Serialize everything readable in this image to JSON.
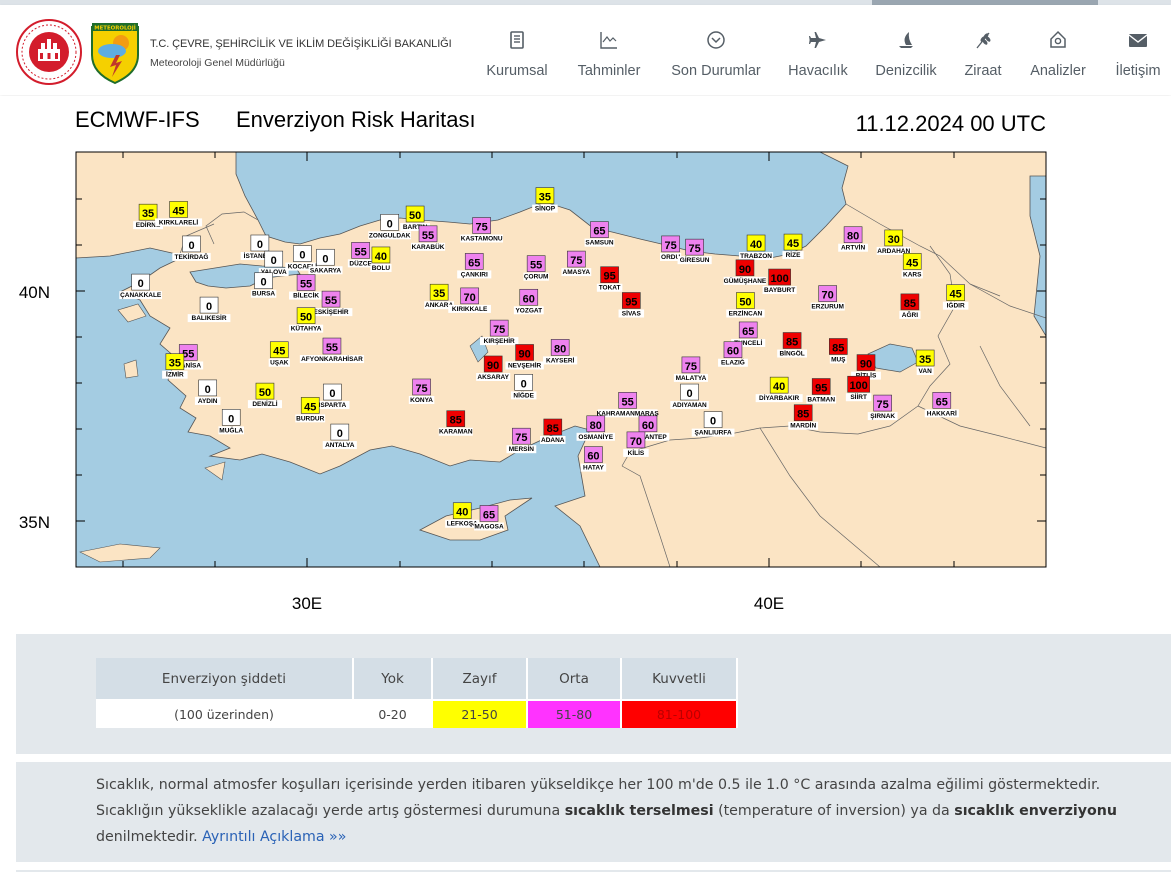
{
  "header": {
    "org_line1": "T.C. ÇEVRE, ŞEHİRCİLİK VE İKLİM DEĞİŞİKLİĞİ BAKANLIĞI",
    "org_line2": "Meteoroloji Genel Müdürlüğü",
    "logo_text": "METEOROLOJİ"
  },
  "nav": [
    {
      "label": "Kurumsal",
      "icon": "document-icon"
    },
    {
      "label": "Tahminler",
      "icon": "chart-icon"
    },
    {
      "label": "Son Durumlar",
      "icon": "chevron-circle-icon"
    },
    {
      "label": "Havacılık",
      "icon": "airplane-icon"
    },
    {
      "label": "Denizcilik",
      "icon": "sailboat-icon"
    },
    {
      "label": "Ziraat",
      "icon": "wheat-icon"
    },
    {
      "label": "Analizler",
      "icon": "analysis-icon"
    },
    {
      "label": "İletişim",
      "icon": "envelope-icon"
    }
  ],
  "map": {
    "model": "ECMWF-IFS",
    "title": "Enverziyon Risk Haritası",
    "date": "11.12.2024 00 UTC",
    "lat_labels": [
      "40N",
      "35N"
    ],
    "lon_labels": [
      "30E",
      "40E"
    ],
    "colors": {
      "yok": "#ffffff",
      "zayif": "#ffff00",
      "orta": "#ee82ee",
      "kuvvetli": "#ee0000",
      "land": "#fbe4c4",
      "sea": "#a4cce2"
    },
    "stations": [
      {
        "name": "EDİRNE",
        "value": "35",
        "lon": 26.56,
        "lat": 41.67
      },
      {
        "name": "KIRKLARELİ",
        "value": "45",
        "lon": 27.22,
        "lat": 41.73
      },
      {
        "name": "TEKİRDAĞ",
        "value": "0",
        "lon": 27.5,
        "lat": 40.98
      },
      {
        "name": "ÇANAKKALE",
        "value": "0",
        "lon": 26.4,
        "lat": 40.15
      },
      {
        "name": "İSTANBUL",
        "value": "0",
        "lon": 28.98,
        "lat": 41.0
      },
      {
        "name": "KOCAELİ",
        "value": "0",
        "lon": 29.9,
        "lat": 40.77
      },
      {
        "name": "YALOVA",
        "value": "0",
        "lon": 29.28,
        "lat": 40.65
      },
      {
        "name": "BURSA",
        "value": "0",
        "lon": 29.06,
        "lat": 40.18
      },
      {
        "name": "SAKARYA",
        "value": "0",
        "lon": 30.4,
        "lat": 40.69
      },
      {
        "name": "DÜZCE",
        "value": "55",
        "lon": 31.16,
        "lat": 40.84
      },
      {
        "name": "ZONGULDAK",
        "value": "0",
        "lon": 31.79,
        "lat": 41.45
      },
      {
        "name": "BARTIN",
        "value": "50",
        "lon": 32.34,
        "lat": 41.63
      },
      {
        "name": "KARABÜK",
        "value": "55",
        "lon": 32.62,
        "lat": 41.2
      },
      {
        "name": "BOLU",
        "value": "40",
        "lon": 31.6,
        "lat": 40.74
      },
      {
        "name": "KASTAMONU",
        "value": "75",
        "lon": 33.78,
        "lat": 41.38
      },
      {
        "name": "SİNOP",
        "value": "35",
        "lon": 35.15,
        "lat": 42.03
      },
      {
        "name": "SAMSUN",
        "value": "65",
        "lon": 36.33,
        "lat": 41.29
      },
      {
        "name": "ÇANKIRI",
        "value": "65",
        "lon": 33.62,
        "lat": 40.6
      },
      {
        "name": "ÇORUM",
        "value": "55",
        "lon": 34.96,
        "lat": 40.55
      },
      {
        "name": "AMASYA",
        "value": "75",
        "lon": 35.83,
        "lat": 40.65
      },
      {
        "name": "TOKAT",
        "value": "95",
        "lon": 36.55,
        "lat": 40.31
      },
      {
        "name": "ORDU",
        "value": "75",
        "lon": 37.87,
        "lat": 40.98
      },
      {
        "name": "GİRESUN",
        "value": "75",
        "lon": 38.39,
        "lat": 40.91
      },
      {
        "name": "TRABZON",
        "value": "40",
        "lon": 39.72,
        "lat": 41.0
      },
      {
        "name": "RİZE",
        "value": "45",
        "lon": 40.52,
        "lat": 41.02
      },
      {
        "name": "ARTVİN",
        "value": "80",
        "lon": 41.82,
        "lat": 41.18
      },
      {
        "name": "ARDAHAN",
        "value": "30",
        "lon": 42.7,
        "lat": 41.11
      },
      {
        "name": "GÜMÜŞHANE",
        "value": "90",
        "lon": 39.48,
        "lat": 40.46
      },
      {
        "name": "BAYBURT",
        "value": "100",
        "lon": 40.23,
        "lat": 40.26
      },
      {
        "name": "KARS",
        "value": "45",
        "lon": 43.1,
        "lat": 40.6
      },
      {
        "name": "IĞDIR",
        "value": "45",
        "lon": 44.04,
        "lat": 39.92
      },
      {
        "name": "ERZURUM",
        "value": "70",
        "lon": 41.27,
        "lat": 39.9
      },
      {
        "name": "ERZİNCAN",
        "value": "50",
        "lon": 39.49,
        "lat": 39.75
      },
      {
        "name": "AĞRI",
        "value": "85",
        "lon": 43.05,
        "lat": 39.72
      },
      {
        "name": "BİLECİK",
        "value": "55",
        "lon": 29.98,
        "lat": 40.14
      },
      {
        "name": "ESKİŞEHİR",
        "value": "55",
        "lon": 30.52,
        "lat": 39.78
      },
      {
        "name": "KÜTAHYA",
        "value": "50",
        "lon": 29.98,
        "lat": 39.42
      },
      {
        "name": "BALIKESİR",
        "value": "0",
        "lon": 27.88,
        "lat": 39.65
      },
      {
        "name": "ANKARA",
        "value": "35",
        "lon": 32.86,
        "lat": 39.93
      },
      {
        "name": "KIRIKKALE",
        "value": "70",
        "lon": 33.52,
        "lat": 39.85
      },
      {
        "name": "YOZGAT",
        "value": "60",
        "lon": 34.8,
        "lat": 39.82
      },
      {
        "name": "SİVAS",
        "value": "95",
        "lon": 37.02,
        "lat": 39.75
      },
      {
        "name": "TUNCELİ",
        "value": "65",
        "lon": 39.55,
        "lat": 39.11
      },
      {
        "name": "BİNGÖL",
        "value": "85",
        "lon": 40.5,
        "lat": 38.88
      },
      {
        "name": "MUŞ",
        "value": "85",
        "lon": 41.5,
        "lat": 38.75
      },
      {
        "name": "KIRŞEHİR",
        "value": "75",
        "lon": 34.16,
        "lat": 39.15
      },
      {
        "name": "NEVŞEHİR",
        "value": "90",
        "lon": 34.71,
        "lat": 38.62
      },
      {
        "name": "AKSARAY",
        "value": "90",
        "lon": 34.03,
        "lat": 38.37
      },
      {
        "name": "KAYSERİ",
        "value": "80",
        "lon": 35.48,
        "lat": 38.73
      },
      {
        "name": "MALATYA",
        "value": "75",
        "lon": 38.31,
        "lat": 38.35
      },
      {
        "name": "ELAZIĞ",
        "value": "60",
        "lon": 39.22,
        "lat": 38.68
      },
      {
        "name": "BİTLİS",
        "value": "90",
        "lon": 42.1,
        "lat": 38.4
      },
      {
        "name": "VAN",
        "value": "35",
        "lon": 43.38,
        "lat": 38.5
      },
      {
        "name": "SİİRT",
        "value": "100",
        "lon": 41.94,
        "lat": 37.93
      },
      {
        "name": "BATMAN",
        "value": "95",
        "lon": 41.13,
        "lat": 37.88
      },
      {
        "name": "DİYARBAKIR",
        "value": "40",
        "lon": 40.22,
        "lat": 37.91
      },
      {
        "name": "ŞIRNAK",
        "value": "75",
        "lon": 42.46,
        "lat": 37.52
      },
      {
        "name": "HAKKARİ",
        "value": "65",
        "lon": 43.74,
        "lat": 37.58
      },
      {
        "name": "MARDİN",
        "value": "85",
        "lon": 40.74,
        "lat": 37.31
      },
      {
        "name": "ADIYAMAN",
        "value": "0",
        "lon": 38.28,
        "lat": 37.76
      },
      {
        "name": "ŞANLIURFA",
        "value": "0",
        "lon": 38.79,
        "lat": 37.16
      },
      {
        "name": "KAHRAMANMARAŞ",
        "value": "55",
        "lon": 36.94,
        "lat": 37.58
      },
      {
        "name": "GAZİANTEP",
        "value": "60",
        "lon": 37.38,
        "lat": 37.07
      },
      {
        "name": "KİLİS",
        "value": "70",
        "lon": 37.12,
        "lat": 36.72
      },
      {
        "name": "OSMANİYE",
        "value": "80",
        "lon": 36.25,
        "lat": 37.07
      },
      {
        "name": "ADANA",
        "value": "85",
        "lon": 35.32,
        "lat": 37.0
      },
      {
        "name": "HATAY",
        "value": "60",
        "lon": 36.2,
        "lat": 36.4
      },
      {
        "name": "MERSİN",
        "value": "75",
        "lon": 34.64,
        "lat": 36.8
      },
      {
        "name": "NİĞDE",
        "value": "0",
        "lon": 34.69,
        "lat": 37.97
      },
      {
        "name": "KARAMAN",
        "value": "85",
        "lon": 33.22,
        "lat": 37.18
      },
      {
        "name": "KONYA",
        "value": "75",
        "lon": 32.48,
        "lat": 37.87
      },
      {
        "name": "AFYONKARAHİSAR",
        "value": "55",
        "lon": 30.54,
        "lat": 38.76
      },
      {
        "name": "UŞAK",
        "value": "45",
        "lon": 29.4,
        "lat": 38.68
      },
      {
        "name": "MANİSA",
        "value": "55",
        "lon": 27.43,
        "lat": 38.62
      },
      {
        "name": "İZMİR",
        "value": "35",
        "lon": 27.14,
        "lat": 38.42
      },
      {
        "name": "AYDIN",
        "value": "0",
        "lon": 27.85,
        "lat": 37.85
      },
      {
        "name": "DENİZLİ",
        "value": "50",
        "lon": 29.09,
        "lat": 37.78
      },
      {
        "name": "ISPARTA",
        "value": "0",
        "lon": 30.55,
        "lat": 37.76
      },
      {
        "name": "BURDUR",
        "value": "45",
        "lon": 30.07,
        "lat": 37.47
      },
      {
        "name": "MUĞLA",
        "value": "0",
        "lon": 28.36,
        "lat": 37.21
      },
      {
        "name": "ANTALYA",
        "value": "0",
        "lon": 30.71,
        "lat": 36.89
      },
      {
        "name": "LEFKOŞA",
        "value": "40",
        "lon": 33.36,
        "lat": 35.18
      },
      {
        "name": "MAGOSA",
        "value": "65",
        "lon": 33.94,
        "lat": 35.12
      }
    ]
  },
  "legend": {
    "header_label": "Enverziyon şiddeti",
    "sub_label": "(100 üzerinden)",
    "categories": [
      {
        "name": "Yok",
        "range": "0-20",
        "color": "#ffffff"
      },
      {
        "name": "Zayıf",
        "range": "21-50",
        "color": "#ffff00"
      },
      {
        "name": "Orta",
        "range": "51-80",
        "color": "#ff33ff"
      },
      {
        "name": "Kuvvetli",
        "range": "81-100",
        "color": "#ff0000"
      }
    ]
  },
  "info": {
    "p1": "Sıcaklık, normal atmosfer koşulları içerisinde yerden itibaren yükseldikçe her 100 m'de 0.5 ile 1.0 °C arasında azalma eğilimi göstermektedir. Sıcaklığın yükseklikle azalacağı yerde artış göstermesi durumuna ",
    "b1": "sıcaklık terselmesi",
    "p2": " (temperature of inversion) ya da ",
    "b2": "sıcaklık enverziyonu",
    "p3": " denilmektedir. ",
    "link": "Ayrıntılı Açıklama »»"
  }
}
